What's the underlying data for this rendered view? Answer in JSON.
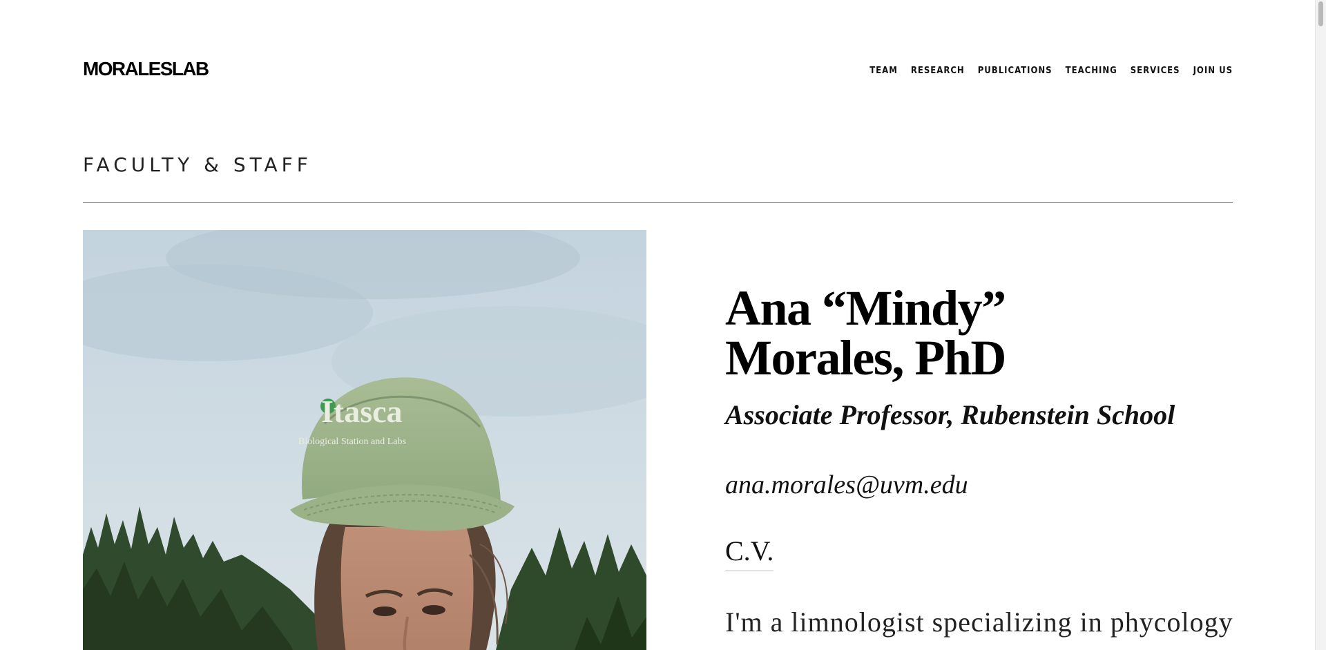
{
  "header": {
    "logo": "MORALESLAB",
    "nav": {
      "team": "TEAM",
      "research": "RESEARCH",
      "publications": "PUBLICATIONS",
      "teaching": "TEACHING",
      "services": "SERVICES",
      "join_us": "JOIN US"
    }
  },
  "main": {
    "section_title": "FACULTY & STAFF",
    "profile": {
      "name": "Ana “Mindy” Morales, PhD",
      "role": "Associate Professor, Rubenstein School",
      "email": "ana.morales@uvm.edu",
      "cv_label": "C.V.",
      "bio_start": "I'm a limnologist specializing in phycology"
    },
    "photo": {
      "cap_text_main": "Itasca",
      "cap_text_sub": "Biological Station and Labs"
    }
  },
  "colors": {
    "background": "#ffffff",
    "text": "#111111",
    "rule": "#7a7a7a",
    "cap": "#9fb48c",
    "sky": "#c7d6df"
  }
}
